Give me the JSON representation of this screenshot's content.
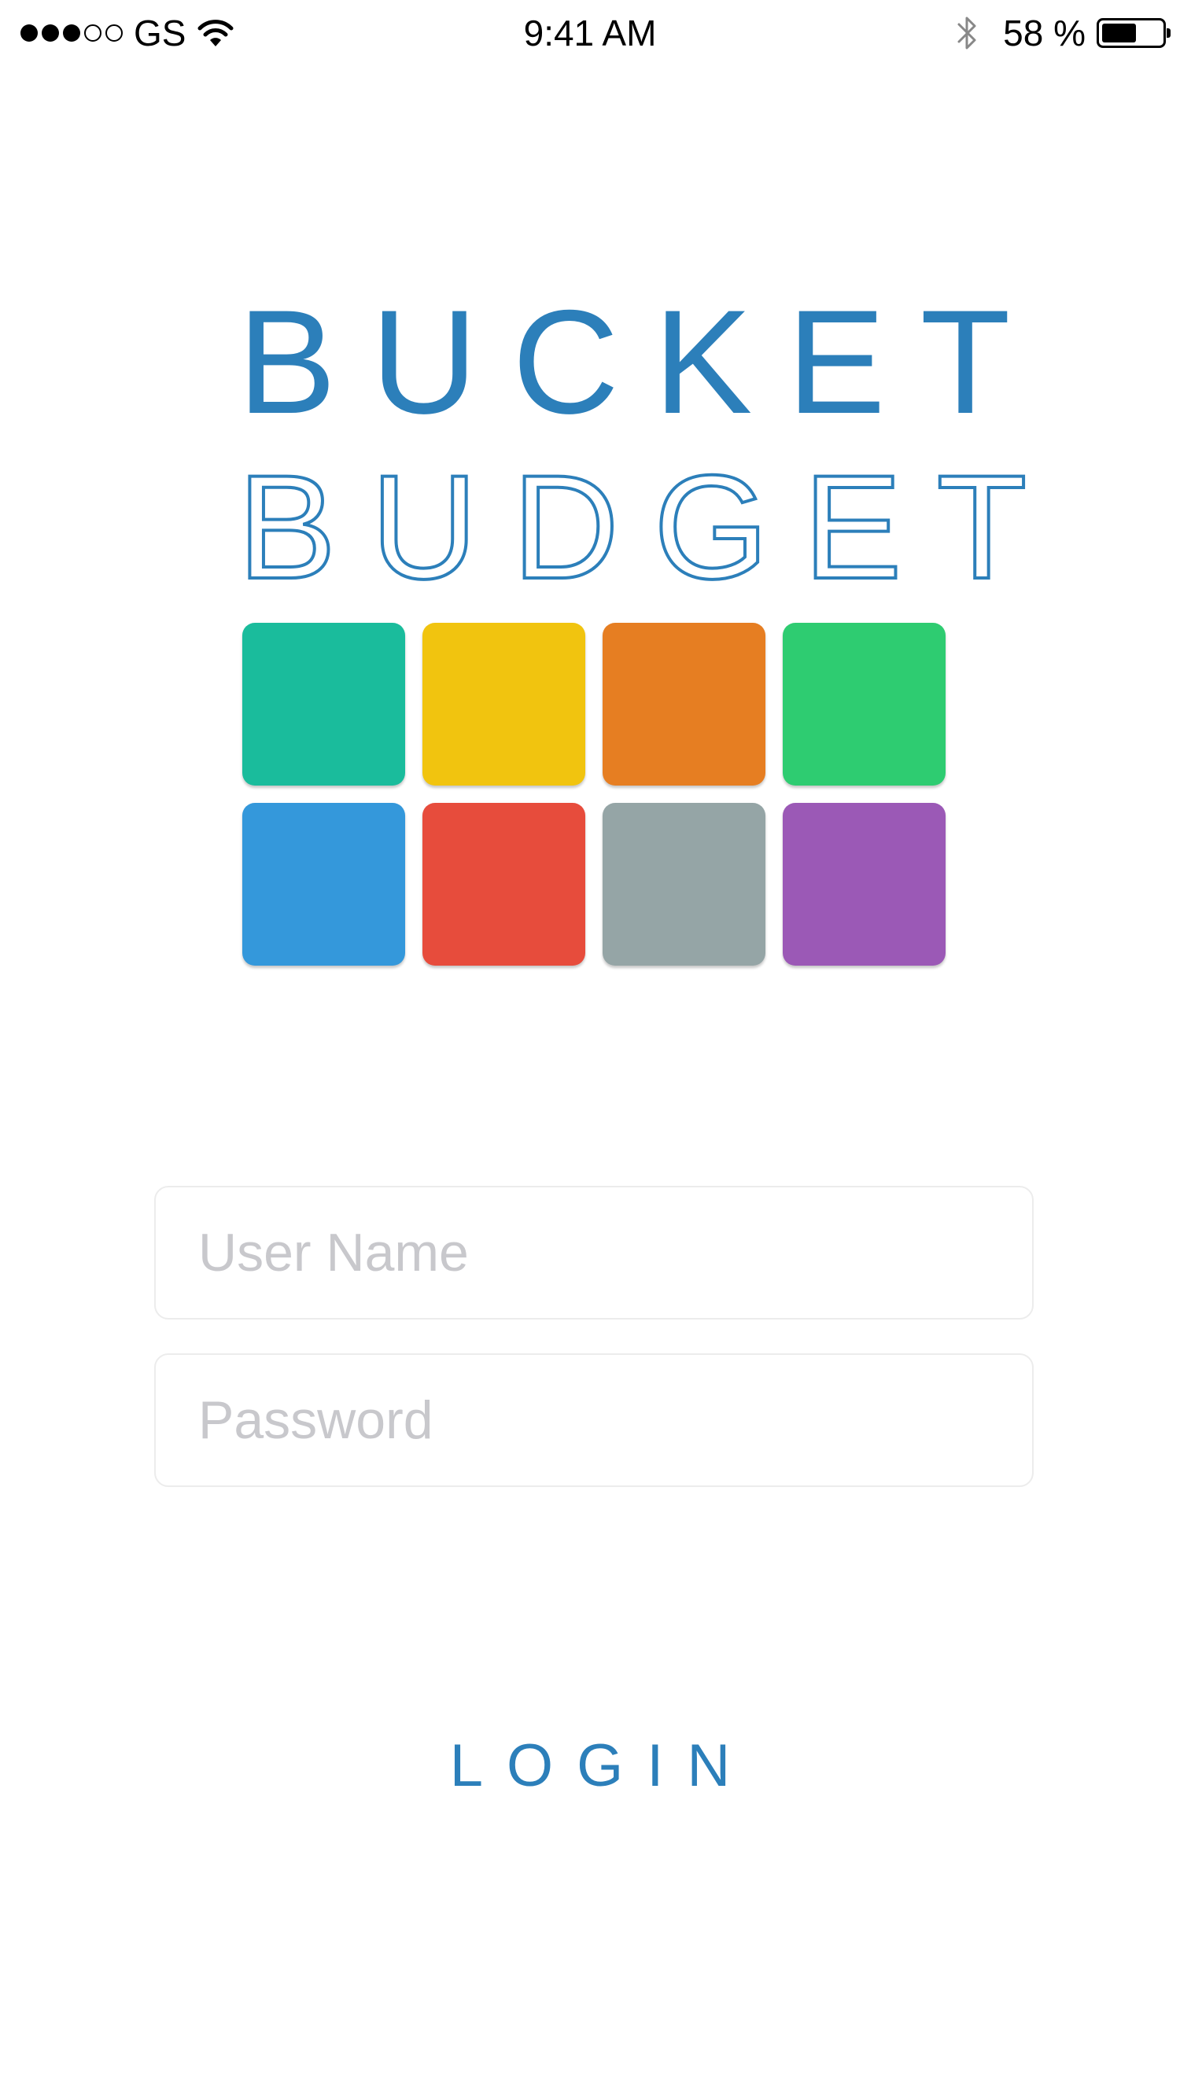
{
  "status_bar": {
    "signal": [
      "filled",
      "filled",
      "filled",
      "empty",
      "empty"
    ],
    "carrier": "GS",
    "time": "9:41 AM",
    "battery_text": "58 %",
    "battery_level": 0.58,
    "icons": [
      "wifi-icon",
      "bluetooth-icon",
      "battery-icon"
    ]
  },
  "logo": {
    "line1": "BUCKET",
    "line2": "BUDGET",
    "color": "#2c7fba",
    "tiles": [
      {
        "color": "#1abc9c"
      },
      {
        "color": "#f1c40f"
      },
      {
        "color": "#e67e22"
      },
      {
        "color": "#2ecc71"
      },
      {
        "color": "#3498db"
      },
      {
        "color": "#e74c3c"
      },
      {
        "color": "#95a5a6"
      },
      {
        "color": "#9b59b6"
      }
    ]
  },
  "form": {
    "username_placeholder": "User Name",
    "username_value": "",
    "password_placeholder": "Password",
    "password_value": ""
  },
  "login": {
    "label": "LOGIN",
    "color": "#2c7fba"
  }
}
